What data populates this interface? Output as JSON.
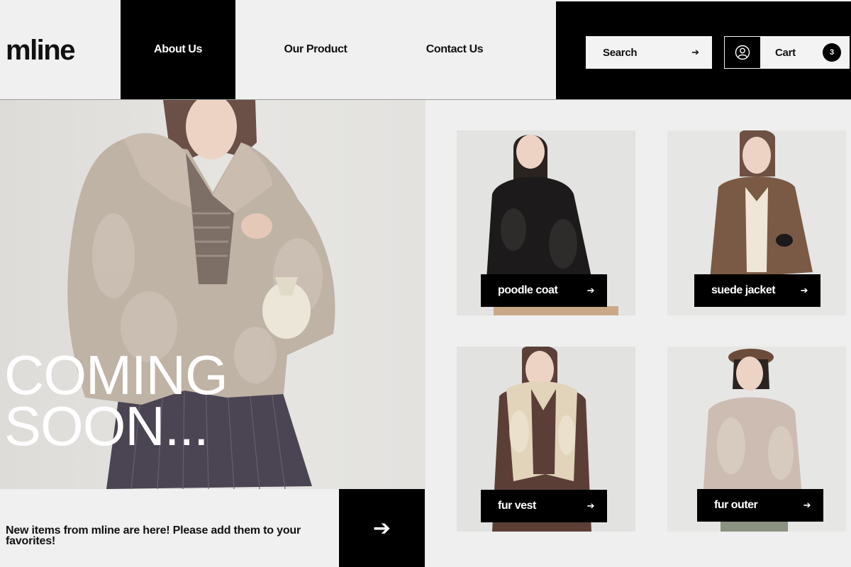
{
  "brand": {
    "logo": "mline"
  },
  "nav": {
    "about": "About Us",
    "product": "Our Product",
    "contact": "Contact Us"
  },
  "search": {
    "label": "Search",
    "icon": "arrow-right-icon"
  },
  "account": {
    "icon": "user-circle-icon"
  },
  "cart": {
    "label": "Cart",
    "count": "3"
  },
  "hero": {
    "headline_line1": "COMING",
    "headline_line2": "SOON..."
  },
  "promo": {
    "text": "New items from mline are here! Please add them to your favorites!",
    "button_icon": "arrow-right-icon"
  },
  "products": [
    {
      "name": "poodle coat",
      "icon": "arrow-right-icon"
    },
    {
      "name": "suede jacket",
      "icon": "arrow-right-icon"
    },
    {
      "name": "fur vest",
      "icon": "arrow-right-icon"
    },
    {
      "name": "fur outer",
      "icon": "arrow-right-icon"
    }
  ],
  "colors": {
    "accent": "#000000",
    "background": "#efefef",
    "text": "#111111"
  }
}
